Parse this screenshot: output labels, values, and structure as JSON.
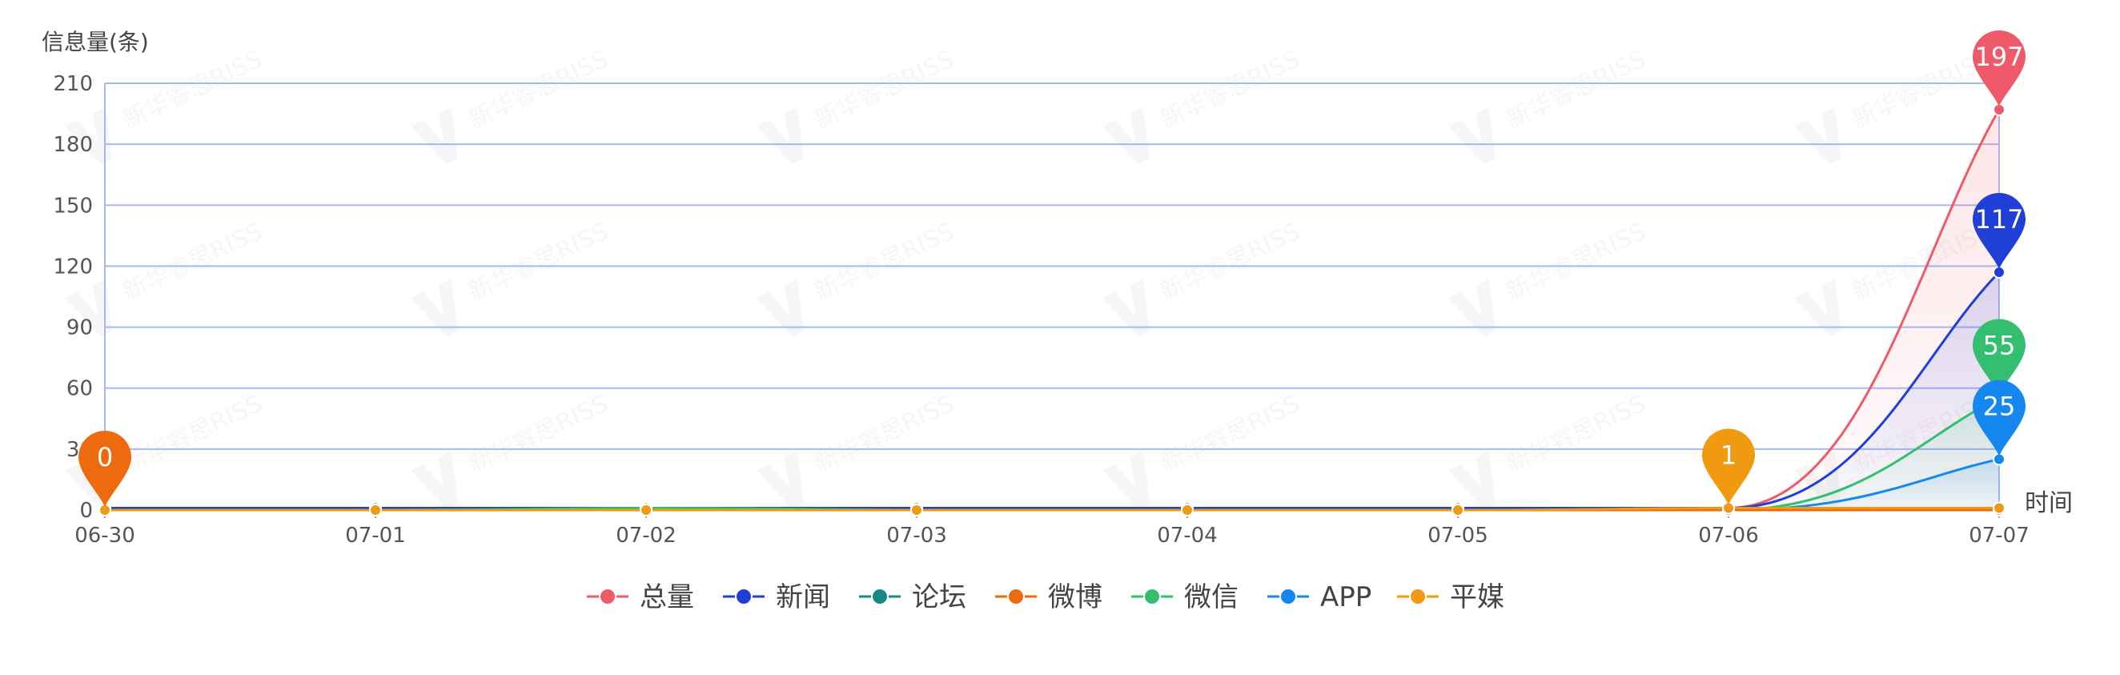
{
  "chart_data": {
    "type": "line",
    "ylabel": "信息量(条)",
    "xlabel": "时间",
    "categories": [
      "06-30",
      "07-01",
      "07-02",
      "07-03",
      "07-04",
      "07-05",
      "07-06",
      "07-07"
    ],
    "y_ticks": [
      "0",
      "30",
      "60",
      "90",
      "120",
      "150",
      "180",
      "210"
    ],
    "ylim": [
      0,
      210
    ],
    "grid": true,
    "legend_position": "bottom-center",
    "watermark": "新华睿思RISS",
    "series": [
      {
        "name": "总量",
        "color": "#ee5a6a",
        "values": [
          1,
          1,
          1,
          1,
          1,
          1,
          1,
          197
        ]
      },
      {
        "name": "新闻",
        "color": "#1f3fd6",
        "values": [
          1,
          1,
          1,
          1,
          1,
          1,
          1,
          117
        ]
      },
      {
        "name": "论坛",
        "color": "#168a86",
        "values": [
          0,
          0,
          0,
          0,
          0,
          0,
          0,
          0
        ]
      },
      {
        "name": "微博",
        "color": "#ee6a0f",
        "values": [
          0,
          0,
          0,
          0,
          0,
          0,
          0,
          0
        ]
      },
      {
        "name": "微信",
        "color": "#33bf6f",
        "values": [
          0,
          0,
          1,
          0,
          0,
          0,
          0,
          55
        ]
      },
      {
        "name": "APP",
        "color": "#1488f0",
        "values": [
          0,
          0,
          0,
          0,
          0,
          0,
          0,
          25
        ]
      },
      {
        "name": "平媒",
        "color": "#ef9a10",
        "values": [
          0,
          0,
          0,
          0,
          0,
          0,
          1,
          1
        ]
      }
    ],
    "markers": [
      {
        "label": "197",
        "series": "总量",
        "index": 7,
        "color": "#ee5a6a"
      },
      {
        "label": "117",
        "series": "新闻",
        "index": 7,
        "color": "#1f3fd6"
      },
      {
        "label": "55",
        "series": "微信",
        "index": 7,
        "color": "#33bf6f"
      },
      {
        "label": "25",
        "series": "APP",
        "index": 7,
        "color": "#1488f0"
      },
      {
        "label": "0",
        "series": "微博",
        "index": 0,
        "color": "#ee6a0f"
      },
      {
        "label": "1",
        "series": "平媒",
        "index": 6,
        "color": "#ef9a10"
      }
    ]
  }
}
